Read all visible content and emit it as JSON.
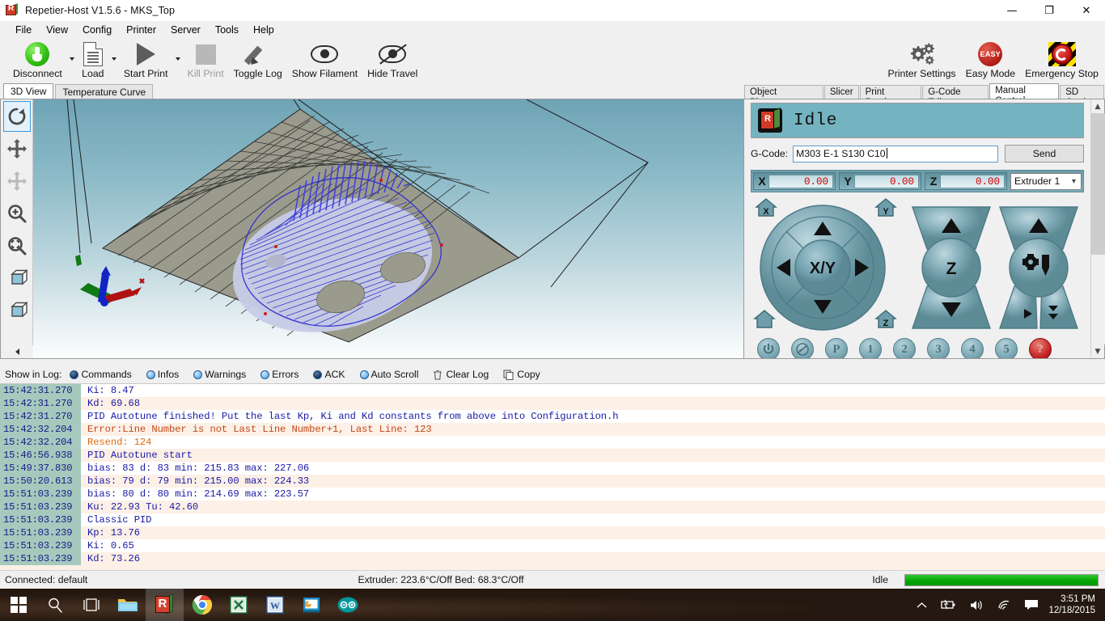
{
  "window": {
    "title": "Repetier-Host V1.5.6 - MKS_Top",
    "minimize": "—",
    "maximize": "❐",
    "close": "✕"
  },
  "menu": [
    "File",
    "View",
    "Config",
    "Printer",
    "Server",
    "Tools",
    "Help"
  ],
  "toolbar": {
    "left": [
      {
        "label": "Disconnect",
        "icon": "plug-icon",
        "caret": true,
        "disabled": false
      },
      {
        "label": "Load",
        "icon": "document-icon",
        "caret": true,
        "disabled": false
      },
      {
        "label": "Start Print",
        "icon": "play-icon",
        "caret": true,
        "disabled": false
      },
      {
        "label": "Kill Print",
        "icon": "stop-icon",
        "caret": false,
        "disabled": true
      },
      {
        "label": "Toggle Log",
        "icon": "pencil-icon",
        "caret": false,
        "disabled": false
      },
      {
        "label": "Show Filament",
        "icon": "eye-icon",
        "caret": false,
        "disabled": false
      },
      {
        "label": "Hide Travel",
        "icon": "eye-slash-icon",
        "caret": false,
        "disabled": false
      }
    ],
    "right": [
      {
        "label": "Printer Settings",
        "icon": "gears-icon"
      },
      {
        "label": "Easy Mode",
        "icon": "easy-badge-icon",
        "badge": "EASY"
      },
      {
        "label": "Emergency Stop",
        "icon": "emergency-stop-icon"
      }
    ]
  },
  "view_tabs": [
    {
      "label": "3D View",
      "active": true
    },
    {
      "label": "Temperature Curve",
      "active": false
    }
  ],
  "view_tools": [
    {
      "name": "rotate-tool",
      "selected": true
    },
    {
      "name": "move-tool",
      "selected": false
    },
    {
      "name": "move-object-tool",
      "selected": false,
      "disabled": true
    },
    {
      "name": "zoom-tool",
      "selected": false
    },
    {
      "name": "zoom-fit-tool",
      "selected": false
    },
    {
      "name": "view-cube-open-tool",
      "selected": false
    },
    {
      "name": "view-cube-solid-tool",
      "selected": false
    }
  ],
  "right_tabs": [
    {
      "label": "Object Placement",
      "active": false
    },
    {
      "label": "Slicer",
      "active": false
    },
    {
      "label": "Print Preview",
      "active": false
    },
    {
      "label": "G-Code Editor",
      "active": false
    },
    {
      "label": "Manual Control",
      "active": true
    },
    {
      "label": "SD Card",
      "active": false
    }
  ],
  "manual_control": {
    "status": "Idle",
    "gcode_label": "G-Code:",
    "gcode_value": "M303 E-1 S130 C10",
    "gcode_placeholder": "",
    "send_label": "Send",
    "coords": [
      {
        "axis": "X",
        "value": "0.00"
      },
      {
        "axis": "Y",
        "value": "0.00"
      },
      {
        "axis": "Z",
        "value": "0.00"
      }
    ],
    "extruder_select": "Extruder 1",
    "pad_xy_center": "X/Y",
    "pad_z_center": "Z",
    "pad_e_center": "extruder-icon",
    "home_buttons": [
      "X",
      "Y",
      "Z",
      "all"
    ],
    "bottom_buttons": [
      "power-icon",
      "no-fan-icon",
      "P",
      "1",
      "2",
      "3",
      "4",
      "5",
      "?"
    ]
  },
  "log": {
    "show_label": "Show in Log:",
    "filters": [
      {
        "label": "Commands",
        "on": true
      },
      {
        "label": "Infos",
        "on": false
      },
      {
        "label": "Warnings",
        "on": false
      },
      {
        "label": "Errors",
        "on": false
      },
      {
        "label": "ACK",
        "on": true
      },
      {
        "label": "Auto Scroll",
        "on": false
      }
    ],
    "actions": [
      {
        "label": "Clear Log",
        "icon": "trash-icon"
      },
      {
        "label": "Copy",
        "icon": "copy-icon"
      }
    ],
    "rows": [
      {
        "ts": "15:42:31.270",
        "msg": "Ki: 8.47",
        "type": "info"
      },
      {
        "ts": "15:42:31.270",
        "msg": "Kd: 69.68",
        "type": "info"
      },
      {
        "ts": "15:42:31.270",
        "msg": "PID Autotune finished! Put the last Kp, Ki and Kd constants from above into Configuration.h",
        "type": "info"
      },
      {
        "ts": "15:42:32.204",
        "msg": "Error:Line Number is not Last Line Number+1, Last Line: 123",
        "type": "error"
      },
      {
        "ts": "15:42:32.204",
        "msg": "Resend: 124",
        "type": "warn"
      },
      {
        "ts": "15:46:56.938",
        "msg": "PID Autotune start",
        "type": "info"
      },
      {
        "ts": "15:49:37.830",
        "msg": "bias: 83 d: 83 min: 215.83 max: 227.06",
        "type": "info"
      },
      {
        "ts": "15:50:20.613",
        "msg": "bias: 79 d: 79 min: 215.00 max: 224.33",
        "type": "info"
      },
      {
        "ts": "15:51:03.239",
        "msg": "bias: 80 d: 80 min: 214.69 max: 223.57",
        "type": "info"
      },
      {
        "ts": "15:51:03.239",
        "msg": "Ku: 22.93 Tu: 42.60",
        "type": "info"
      },
      {
        "ts": "15:51:03.239",
        "msg": "Classic PID",
        "type": "info"
      },
      {
        "ts": "15:51:03.239",
        "msg": "Kp: 13.76",
        "type": "info"
      },
      {
        "ts": "15:51:03.239",
        "msg": "Ki: 0.65",
        "type": "info"
      },
      {
        "ts": "15:51:03.239",
        "msg": "Kd: 73.26",
        "type": "info"
      }
    ]
  },
  "statusbar": {
    "connection": "Connected: default",
    "temps": "Extruder: 223.6°C/Off Bed: 68.3°C/Off",
    "job_state": "Idle",
    "progress_percent": 100
  },
  "taskbar": {
    "items": [
      {
        "name": "start-button",
        "icon": "windows-logo-icon"
      },
      {
        "name": "search-button",
        "icon": "search-icon"
      },
      {
        "name": "task-view-button",
        "icon": "task-view-icon"
      },
      {
        "name": "file-explorer",
        "icon": "folder-icon"
      },
      {
        "name": "repetier-host",
        "icon": "repetier-icon",
        "active": true
      },
      {
        "name": "google-chrome",
        "icon": "chrome-icon"
      },
      {
        "name": "excel",
        "icon": "excel-icon"
      },
      {
        "name": "word",
        "icon": "word-icon"
      },
      {
        "name": "powerpoint",
        "icon": "powerpoint-icon"
      },
      {
        "name": "arduino",
        "icon": "arduino-icon"
      }
    ],
    "tray": [
      "show-hidden-icons",
      "battery-icon",
      "volume-icon",
      "wifi-icon",
      "action-center-icon"
    ],
    "clock_time": "3:51 PM",
    "clock_date": "12/18/2015"
  },
  "colors": {
    "accent_teal": "#74b3c0",
    "pad_blue": "#7aa7b3",
    "log_bg": "#fdf0e6",
    "log_ts_bg": "#a5c9bd",
    "log_text": "#1a1aa8",
    "error_text": "#c14a1a",
    "progress_green": "#06a706",
    "coord_value_red": "#d40000"
  }
}
